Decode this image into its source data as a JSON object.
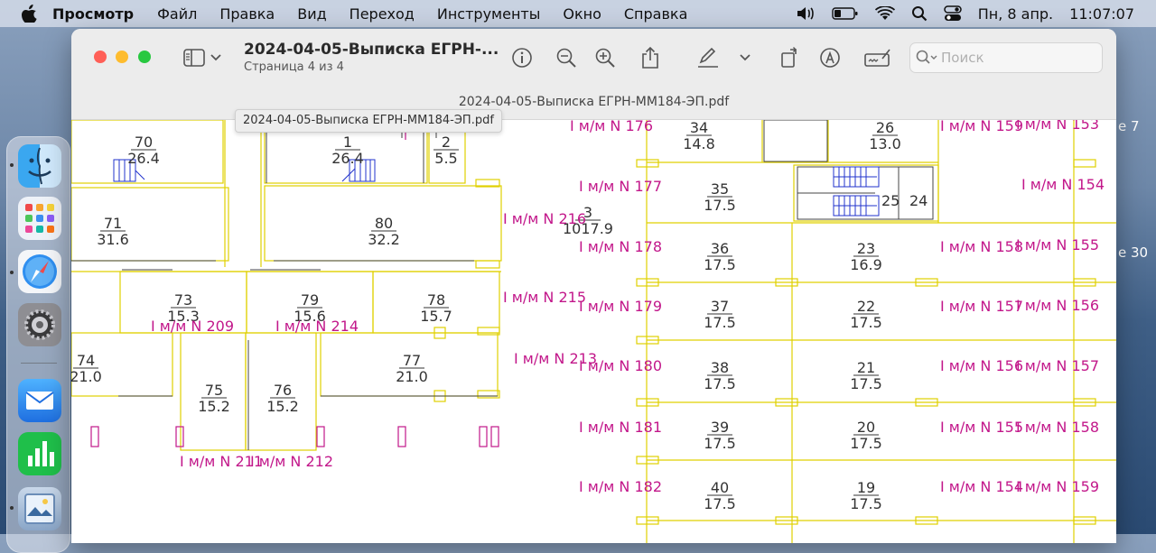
{
  "menubar": {
    "app_name": "Просмотр",
    "items": [
      "Файл",
      "Правка",
      "Вид",
      "Переход",
      "Инструменты",
      "Окно",
      "Справка"
    ],
    "status": {
      "date": "Пн, 8 апр.",
      "time": "11:07:07"
    }
  },
  "desktop": {
    "labels": [
      "e 7",
      "e 30"
    ]
  },
  "window": {
    "title": "2024-04-05-Выписка ЕГРН-...",
    "subtitle": "Страница 4 из 4",
    "file_name": "2024-04-05-Выписка ЕГРН-ММ184-ЭП.pdf",
    "tooltip": "2024-04-05-Выписка ЕГРН-ММ184-ЭП.pdf",
    "search": {
      "placeholder": "Поиск",
      "value": ""
    }
  },
  "plan": {
    "rooms": [
      {
        "num": "70",
        "area": "26.4"
      },
      {
        "num": "1",
        "area": "26.4"
      },
      {
        "num": "2",
        "area": "5.5"
      },
      {
        "num": "71",
        "area": "31.6"
      },
      {
        "num": "80",
        "area": "32.2"
      },
      {
        "num": "73",
        "area": "15.3"
      },
      {
        "num": "79",
        "area": "15.6"
      },
      {
        "num": "78",
        "area": "15.7"
      },
      {
        "num": "74",
        "area": "21.0"
      },
      {
        "num": "77",
        "area": "21.0"
      },
      {
        "num": "75",
        "area": "15.2"
      },
      {
        "num": "76",
        "area": "15.2"
      },
      {
        "num": "3",
        "area": "1017.9"
      },
      {
        "num": "34",
        "area": "14.8"
      },
      {
        "num": "26",
        "area": "13.0"
      },
      {
        "num": "35",
        "area": "17.5"
      },
      {
        "num": "36",
        "area": "17.5"
      },
      {
        "num": "23",
        "area": "16.9"
      },
      {
        "num": "37",
        "area": "17.5"
      },
      {
        "num": "22",
        "area": "17.5"
      },
      {
        "num": "38",
        "area": "17.5"
      },
      {
        "num": "21",
        "area": "17.5"
      },
      {
        "num": "39",
        "area": "17.5"
      },
      {
        "num": "20",
        "area": "17.5"
      },
      {
        "num": "40",
        "area": "17.5"
      },
      {
        "num": "19",
        "area": "17.5"
      }
    ],
    "stair_labels": [
      "25",
      "24"
    ],
    "parking": [
      "I м/м N 176",
      "I м/м N 159",
      "I м/м N 153",
      "I м/м N 177",
      "I м/м N 154",
      "I м/м N 216",
      "I м/м N 178",
      "I м/м N 158",
      "I м/м N 155",
      "I м/м N 215",
      "I м/м N 179",
      "I м/м N 157",
      "I м/м N 156",
      "I м/м N 209",
      "I м/м N 214",
      "I м/м N 213",
      "I м/м N 180",
      "I м/м N 156",
      "I м/м N 157",
      "I м/м N 181",
      "I м/м N 155",
      "I м/м N 158",
      "I м/м N 211",
      "I м/м N 212",
      "I м/м N 182",
      "I м/м N 154",
      "I м/м N 159"
    ]
  }
}
